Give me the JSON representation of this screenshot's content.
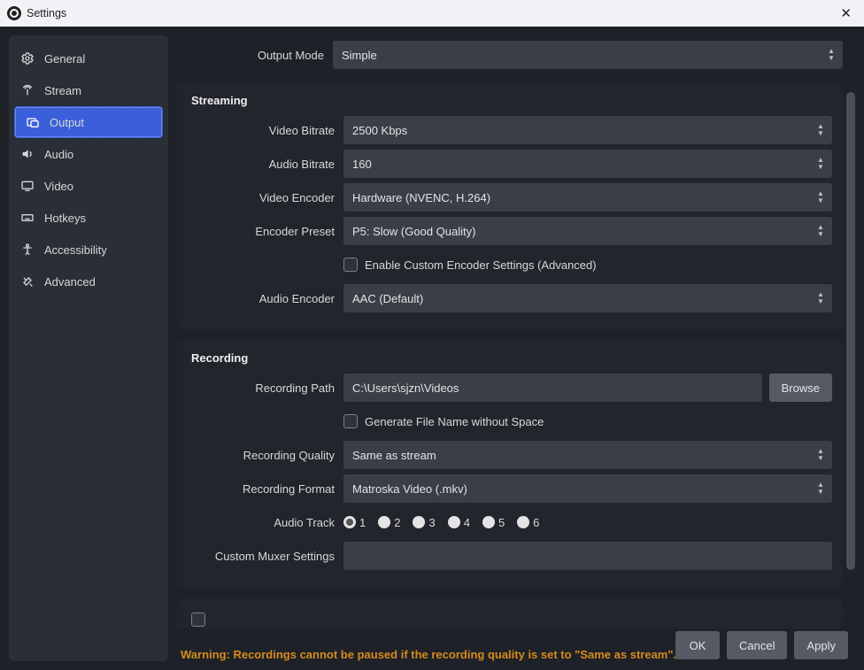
{
  "window": {
    "title": "Settings"
  },
  "sidebar": {
    "items": [
      {
        "label": "General"
      },
      {
        "label": "Stream"
      },
      {
        "label": "Output"
      },
      {
        "label": "Audio"
      },
      {
        "label": "Video"
      },
      {
        "label": "Hotkeys"
      },
      {
        "label": "Accessibility"
      },
      {
        "label": "Advanced"
      }
    ],
    "active_index": 2
  },
  "output_mode": {
    "label": "Output Mode",
    "value": "Simple"
  },
  "streaming": {
    "title": "Streaming",
    "video_bitrate": {
      "label": "Video Bitrate",
      "value": "2500 Kbps"
    },
    "audio_bitrate": {
      "label": "Audio Bitrate",
      "value": "160"
    },
    "video_encoder": {
      "label": "Video Encoder",
      "value": "Hardware (NVENC, H.264)"
    },
    "encoder_preset": {
      "label": "Encoder Preset",
      "value": "P5: Slow (Good Quality)"
    },
    "custom_encoder_cb": {
      "label": "Enable Custom Encoder Settings (Advanced)",
      "checked": false
    },
    "audio_encoder": {
      "label": "Audio Encoder",
      "value": "AAC (Default)"
    }
  },
  "recording": {
    "title": "Recording",
    "path": {
      "label": "Recording Path",
      "value": "C:\\Users\\sjzn\\Videos"
    },
    "browse": "Browse",
    "filename_cb": {
      "label": "Generate File Name without Space",
      "checked": false
    },
    "quality": {
      "label": "Recording Quality",
      "value": "Same as stream"
    },
    "format": {
      "label": "Recording Format",
      "value": "Matroska Video (.mkv)"
    },
    "audio_track": {
      "label": "Audio Track",
      "options": [
        "1",
        "2",
        "3",
        "4",
        "5",
        "6"
      ],
      "selected": "1"
    },
    "muxer": {
      "label": "Custom Muxer Settings",
      "value": ""
    }
  },
  "warning": "Warning: Recordings cannot be paused if the recording quality is set to \"Same as stream\".",
  "footer": {
    "ok": "OK",
    "cancel": "Cancel",
    "apply": "Apply"
  }
}
